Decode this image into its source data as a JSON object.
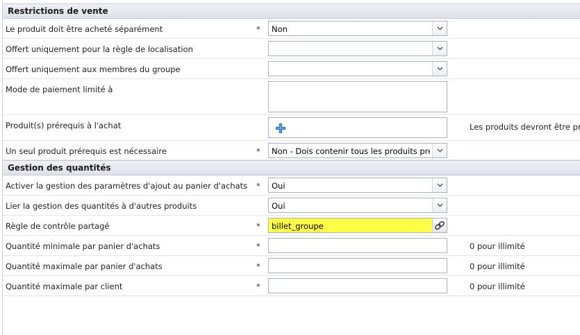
{
  "sections": [
    {
      "title": "Restrictions de vente",
      "rows": [
        {
          "label": "Le produit doit être acheté séparément",
          "required": "*",
          "value": "Non"
        },
        {
          "label": "Offert uniquement pour la règle de localisation",
          "value": ""
        },
        {
          "label": "Offert uniquement aux membres du groupe",
          "value": ""
        },
        {
          "label": "Mode de paiement limité à",
          "value": ""
        },
        {
          "label": "Produit(s) prérequis à l'achat",
          "note": "Les produits devront être pré"
        },
        {
          "label": "Un seul produit prérequis est nécessaire",
          "required": "*",
          "value": "Non - Dois contenir tous les produits prér"
        }
      ]
    },
    {
      "title": "Gestion des quantités",
      "rows": [
        {
          "label": "Activer la gestion des paramètres d'ajout au panier d'achats",
          "required": "*",
          "value": "Oui"
        },
        {
          "label": "Lier la gestion des quantités à d'autres produits",
          "value": "Oui"
        },
        {
          "label": "Règle de contrôle partagé",
          "required": "*",
          "value": "billet_groupe"
        },
        {
          "label": "Quantité minimale par panier d'achats",
          "required": "*",
          "value": "",
          "note": "0 pour illimité"
        },
        {
          "label": "Quantité maximale par panier d'achats",
          "required": "*",
          "value": "",
          "note": "0 pour illimité"
        },
        {
          "label": "Quantité maximale par client",
          "required": "*",
          "value": "",
          "note": "0 pour illimité"
        }
      ]
    }
  ],
  "colors": {
    "highlight": "#ffff47",
    "plus_icon": "#1e6fc0"
  }
}
